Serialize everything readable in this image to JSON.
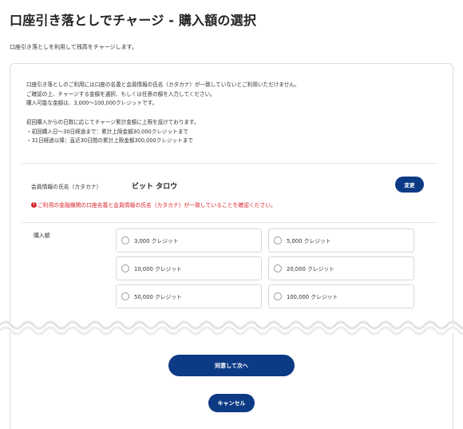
{
  "page": {
    "title": "口座引き落としでチャージ - 購入額の選択",
    "subtitle": "口座引き落としを利用して残高をチャージします。"
  },
  "intro": {
    "lines_a": [
      "口座引き落としのご利用には口座の名義と会員情報の氏名（カタカナ）が一致していないとご利用いただけません。",
      "ご確認の上、チャージする金額を選択、もしくは任意の額を入力してください。",
      "購入可能な金額は、3,000～100,000クレジットです。"
    ],
    "lines_b": [
      "初回購入からの日数に応じてチャージ累計金額に上限を設けております。",
      "・初回購入日～30日経過まで：累計上限金額30,000クレジットまで",
      "・31日経過以降：直近30日間の累計上限金額300,000クレジットまで"
    ]
  },
  "member": {
    "name_label": "会員情報の氏名（カタカナ）",
    "name_value": "ビット タロウ",
    "change_label": "変更"
  },
  "notice": {
    "icon": "exclamation-circle-icon",
    "text": "ご利用の金融機関の口座名義と会員情報の氏名（カタカナ）が一致していることを確認ください。"
  },
  "amount": {
    "label": "購入額",
    "options": [
      {
        "label": "3,000 クレジット",
        "selected": false
      },
      {
        "label": "5,000 クレジット",
        "selected": false
      },
      {
        "label": "10,000 クレジット",
        "selected": false
      },
      {
        "label": "20,000 クレジット",
        "selected": false
      },
      {
        "label": "50,000 クレジット",
        "selected": false
      },
      {
        "label": "100,000 クレジット",
        "selected": false
      }
    ]
  },
  "actions": {
    "next_label": "同意して次へ",
    "cancel_label": "キャンセル"
  },
  "colors": {
    "brand": "#0d3a85",
    "alert": "#d8252b",
    "border": "#d9d9d9"
  }
}
